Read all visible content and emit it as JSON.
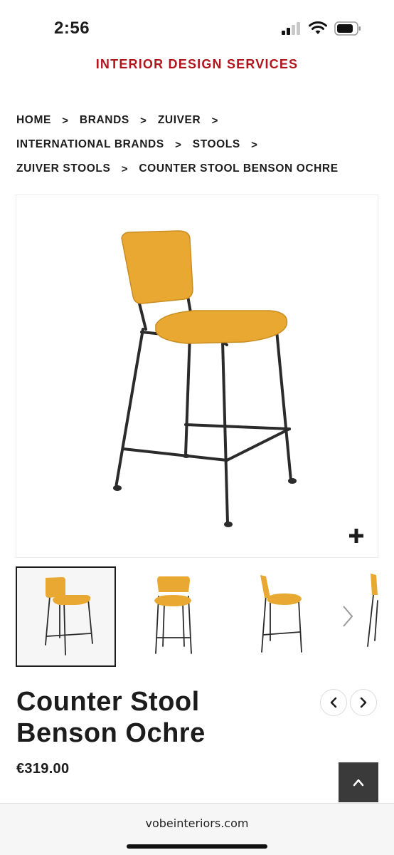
{
  "status_bar": {
    "time": "2:56"
  },
  "header": {
    "site_title": "INTERIOR DESIGN SERVICES"
  },
  "breadcrumb": {
    "items": [
      "HOME",
      "BRANDS",
      "ZUIVER",
      "INTERNATIONAL BRANDS",
      "STOOLS",
      "ZUIVER STOOLS",
      "COUNTER STOOL BENSON OCHRE"
    ],
    "separator": ">"
  },
  "product": {
    "title_line1": "Counter Stool",
    "title_line2": "Benson Ochre",
    "price": "€319.00"
  },
  "gallery": {
    "thumbnail_count_visible": 4,
    "active_index": 0
  },
  "browser": {
    "url": "vobeinteriors.com"
  },
  "colors": {
    "brand_red": "#b3151d",
    "ochre": "#e8a832",
    "frame": "#2b2b2b"
  },
  "icons": [
    "signal-icon",
    "wifi-icon",
    "battery-icon",
    "zoom-plus-icon",
    "chevron-right-icon",
    "chevron-left-icon",
    "arrow-up-icon"
  ]
}
